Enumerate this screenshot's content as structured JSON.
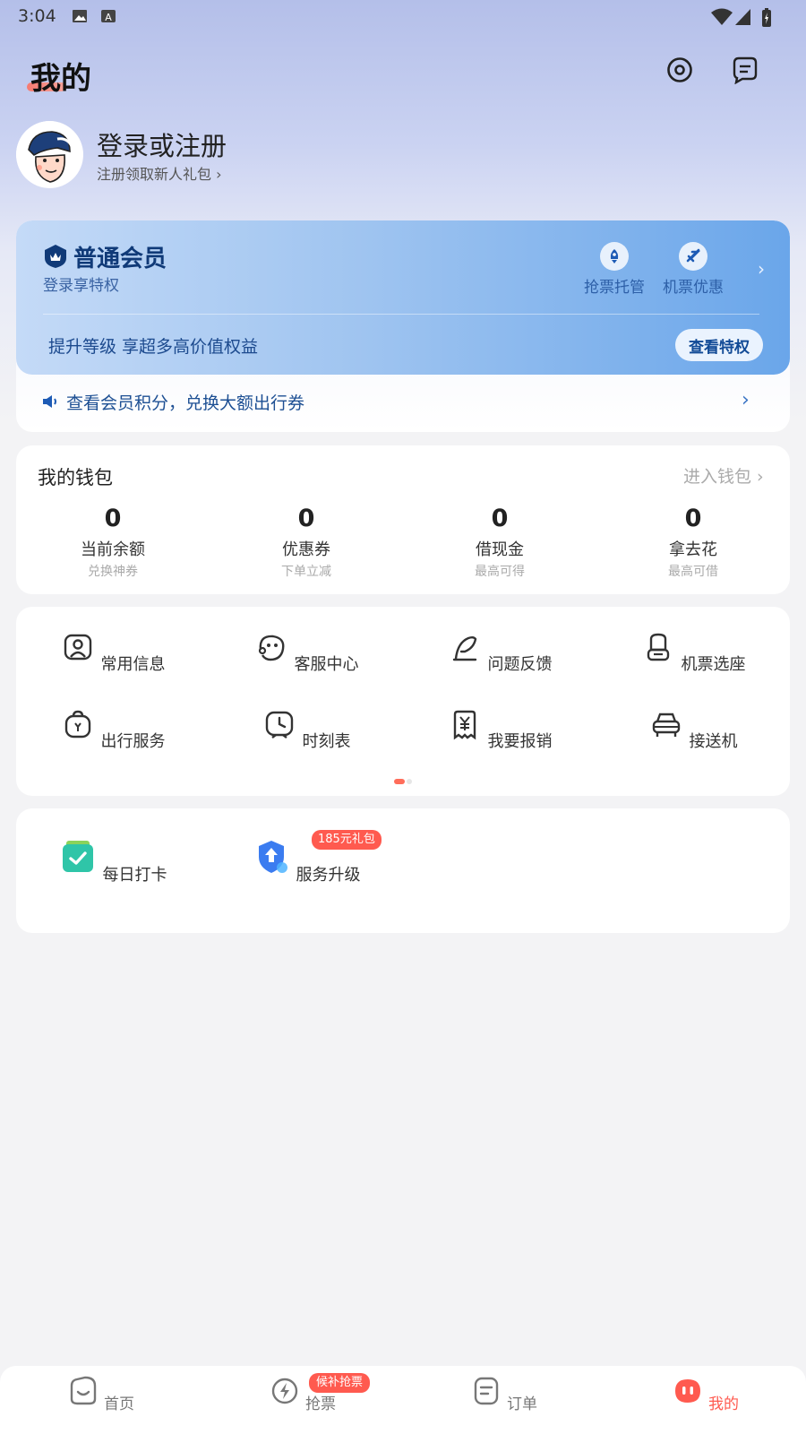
{
  "status": {
    "time": "3:04"
  },
  "header": {
    "title": "我的",
    "settings_icon": "settings-icon",
    "message_icon": "message-icon"
  },
  "profile": {
    "title": "登录或注册",
    "subtitle": "注册领取新人礼包 ›"
  },
  "member": {
    "level": "普通会员",
    "sub": "登录享特权",
    "features": [
      {
        "label": "抢票托管",
        "icon": "rocket-icon"
      },
      {
        "label": "机票优惠",
        "icon": "plane-icon"
      }
    ],
    "promo": "提升等级 享超多高价值权益",
    "button": "查看特权",
    "points_text": "查看会员积分，兑换大额出行券"
  },
  "wallet": {
    "title": "我的钱包",
    "link": "进入钱包 ›",
    "items": [
      {
        "value": "0",
        "label": "当前余额",
        "sub": "兑换神券"
      },
      {
        "value": "0",
        "label": "优惠券",
        "sub": "下单立减"
      },
      {
        "value": "0",
        "label": "借现金",
        "sub": "最高可得"
      },
      {
        "value": "0",
        "label": "拿去花",
        "sub": "最高可借"
      }
    ]
  },
  "tools": [
    {
      "label": "常用信息",
      "icon": "contact-card-icon"
    },
    {
      "label": "客服中心",
      "icon": "customer-service-icon"
    },
    {
      "label": "问题反馈",
      "icon": "feedback-icon"
    },
    {
      "label": "机票选座",
      "icon": "seat-icon"
    },
    {
      "label": "出行服务",
      "icon": "travel-bag-icon"
    },
    {
      "label": "时刻表",
      "icon": "clock-icon"
    },
    {
      "label": "我要报销",
      "icon": "receipt-icon"
    },
    {
      "label": "接送机",
      "icon": "car-icon"
    }
  ],
  "extras": [
    {
      "label": "每日打卡",
      "icon": "checkin-icon"
    },
    {
      "label": "服务升级",
      "icon": "upgrade-shield-icon",
      "badge": "185元礼包"
    }
  ],
  "nav": {
    "items": [
      {
        "label": "首页",
        "icon": "home-icon"
      },
      {
        "label": "抢票",
        "icon": "ticket-grab-icon",
        "badge": "候补抢票"
      },
      {
        "label": "订单",
        "icon": "order-icon"
      },
      {
        "label": "我的",
        "icon": "mine-icon",
        "active": true
      }
    ]
  },
  "colors": {
    "accent": "#ff5a4f",
    "member_blue": "#103a78"
  }
}
